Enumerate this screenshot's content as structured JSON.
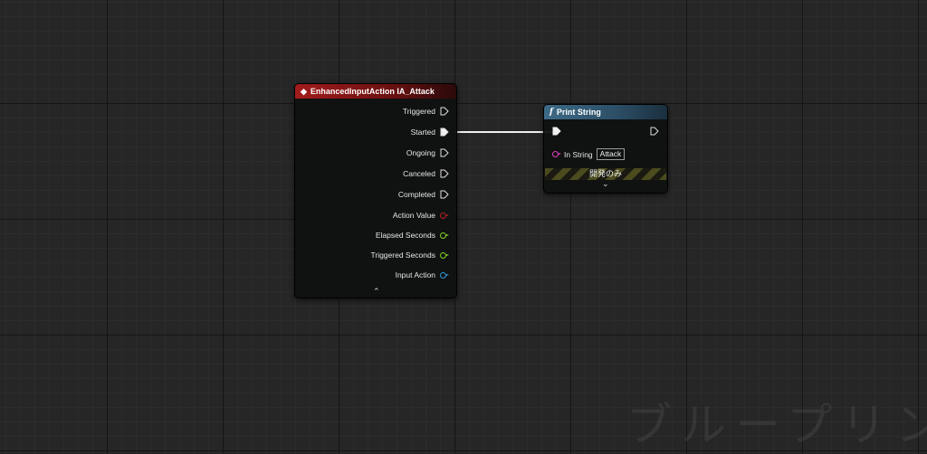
{
  "event_node": {
    "title": "EnhancedInputAction IA_Attack",
    "outputs": [
      {
        "label": "Triggered",
        "kind": "exec"
      },
      {
        "label": "Started",
        "kind": "exec_connected"
      },
      {
        "label": "Ongoing",
        "kind": "exec"
      },
      {
        "label": "Canceled",
        "kind": "exec"
      },
      {
        "label": "Completed",
        "kind": "exec"
      },
      {
        "label": "Action Value",
        "kind": "data",
        "color": "#b02525"
      },
      {
        "label": "Elapsed Seconds",
        "kind": "data",
        "color": "#7ed321"
      },
      {
        "label": "Triggered Seconds",
        "kind": "data",
        "color": "#7ed321"
      },
      {
        "label": "Input Action",
        "kind": "data",
        "color": "#2e9ad6"
      }
    ],
    "collapse_glyph": "⌃"
  },
  "print_node": {
    "title": "Print String",
    "function_glyph": "f",
    "in_string_label": "In String",
    "in_string_value": "Attack",
    "in_string_pin_color": "#e040c0",
    "dev_only_label": "開発のみ",
    "expand_glyph": "⌄"
  },
  "watermark": "ブループリント"
}
